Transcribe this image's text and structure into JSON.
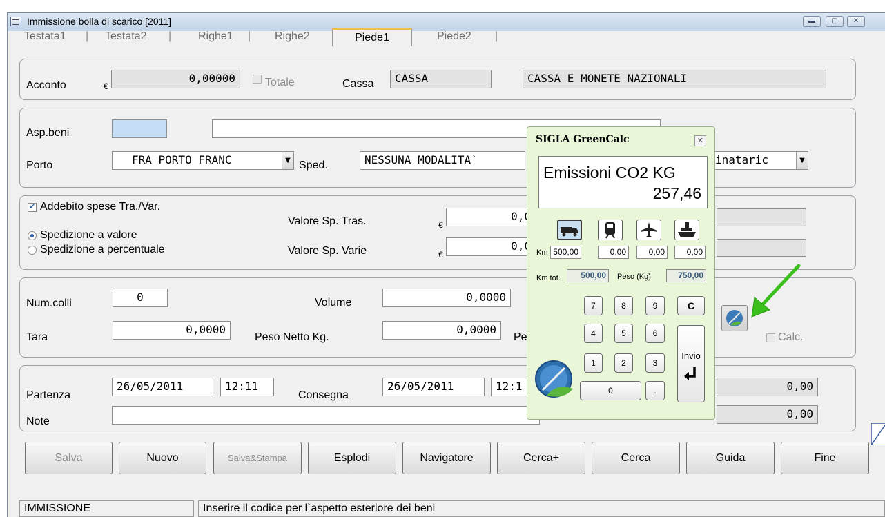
{
  "window": {
    "title": "Immissione bolla di scarico [2011]",
    "controls": [
      "minimize",
      "maximize",
      "close"
    ]
  },
  "tabs": [
    {
      "label": "Testata1",
      "active": false
    },
    {
      "label": "Testata2",
      "active": false
    },
    {
      "label": "Righe1",
      "active": false
    },
    {
      "label": "Righe2",
      "active": false
    },
    {
      "label": "Piede1",
      "active": true
    },
    {
      "label": "Piede2",
      "active": false
    }
  ],
  "tab_separator": "|",
  "acconto": {
    "label": "Acconto",
    "currency": "€",
    "value": "0,00000",
    "totale_label": "Totale",
    "cassa_label": "Cassa",
    "cassa_code": "CASSA",
    "cassa_desc": "CASSA E MONETE NAZIONALI"
  },
  "beni": {
    "asp_label": "Asp.beni",
    "asp_code": "",
    "asp_desc": "",
    "porto_label": "Porto",
    "porto_value": "FRA  PORTO FRANC",
    "sped_label": "Sped.",
    "sped_value": "NESSUNA MODALITA`",
    "dest_value": "inataric"
  },
  "spese": {
    "addebito_label": "Addebito spese Tra./Var.",
    "addebito_checked": true,
    "radio_valore": "Spedizione a valore",
    "radio_percentuale": "Spedizione a percentuale",
    "valore_tras_label": "Valore Sp. Tras.",
    "valore_tras": "0,0",
    "valore_varie_label": "Valore Sp. Varie",
    "valore_varie": "0,0",
    "currency": "€"
  },
  "colli": {
    "num_label": "Num.colli",
    "num_value": "0",
    "volume_label": "Volume",
    "volume_value": "0,0000",
    "tara_label": "Tara",
    "tara_value": "0,0000",
    "peso_netto_label": "Peso Netto Kg.",
    "peso_netto_value": "0,0000",
    "peso_lordo_label_partial": "Pe",
    "calc_label": "Calc."
  },
  "date": {
    "partenza_label": "Partenza",
    "partenza_date": "26/05/2011",
    "partenza_time": "12:11",
    "consegna_label": "Consegna",
    "consegna_date": "26/05/2011",
    "consegna_time": "12:1",
    "right_value_1": "0,00",
    "note_label": "Note",
    "note_value": "",
    "right_value_2": "0,00"
  },
  "buttons": [
    {
      "label": "Salva",
      "enabled": false
    },
    {
      "label": "Nuovo",
      "enabled": true
    },
    {
      "label": "Salva&Stampa",
      "enabled": false
    },
    {
      "label": "Esplodi",
      "enabled": true
    },
    {
      "label": "Navigatore",
      "enabled": true
    },
    {
      "label": "Cerca+",
      "enabled": true
    },
    {
      "label": "Cerca",
      "enabled": true
    },
    {
      "label": "Guida",
      "enabled": true
    },
    {
      "label": "Fine",
      "enabled": true
    }
  ],
  "status": {
    "mode": "IMMISSIONE",
    "message": "Inserire il codice per l`aspetto esteriore dei beni"
  },
  "greencalc": {
    "title": "SIGLA GreenCalc",
    "display_label": "Emissioni CO2  KG",
    "display_value": "257,46",
    "modes": [
      "truck-icon",
      "train-icon",
      "plane-icon",
      "ship-icon"
    ],
    "km_label": "Km",
    "km_values": [
      "500,00",
      "0,00",
      "0,00",
      "0,00"
    ],
    "km_tot_label": "Km tot.",
    "km_tot": "500,00",
    "peso_label": "Peso (Kg)",
    "peso": "750,00",
    "keys": {
      "k7": "7",
      "k8": "8",
      "k9": "9",
      "clear": "C",
      "k4": "4",
      "k5": "5",
      "k6": "6",
      "k1": "1",
      "k2": "2",
      "k3": "3",
      "k0": "0",
      "dot": ".",
      "enter": "Invio"
    }
  },
  "colors": {
    "window_bg": "#f0f0f0",
    "greencalc_bg": "#e9f6d8",
    "arrow_green": "#3bbf1c",
    "field_blue": "#c5def5"
  }
}
